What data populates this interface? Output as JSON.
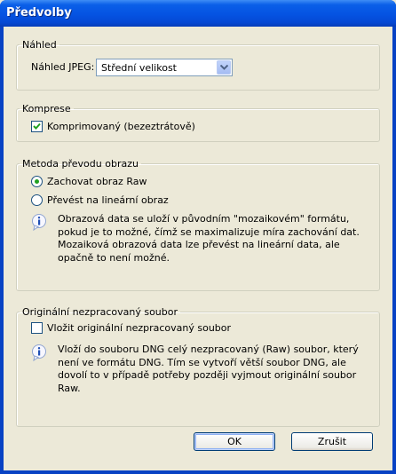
{
  "window": {
    "title": "Předvolby"
  },
  "preview": {
    "legend": "Náhled",
    "jpeg_label": "Náhled JPEG:",
    "jpeg_value": "Střední velikost"
  },
  "compression": {
    "legend": "Komprese",
    "checkbox_label": "Komprimovaný (bezeztrátově)",
    "checked": true
  },
  "conversion": {
    "legend": "Metoda převodu obrazu",
    "option_keep": "Zachovat obraz Raw",
    "option_linear": "Převést na lineární obraz",
    "selected": "keep",
    "info_text": "Obrazová data se uloží v původním \"mozaikovém\" formátu, pokud je to možné, čímž se maximalizuje míra zachování dat.  Mozaiková obrazová data lze převést na lineární data, ale opačně to není možné."
  },
  "original": {
    "legend": "Originální nezpracovaný soubor",
    "checkbox_label": "Vložit originální nezpracovaný soubor",
    "checked": false,
    "info_text": "Vloží do souboru DNG celý nezpracovaný (Raw) soubor, který není ve formátu DNG.  Tím se vytvoří větší soubor DNG, ale dovolí to v případě potřeby později vyjmout originální soubor Raw."
  },
  "buttons": {
    "ok": "OK",
    "cancel": "Zrušit"
  },
  "colors": {
    "title_bar": "#0553E2",
    "dialog_bg": "#ECE9D8",
    "radio_dot": "#21A121"
  },
  "icons": {
    "info": "info-icon",
    "dropdown": "chevron-down-icon",
    "check": "check-icon"
  }
}
